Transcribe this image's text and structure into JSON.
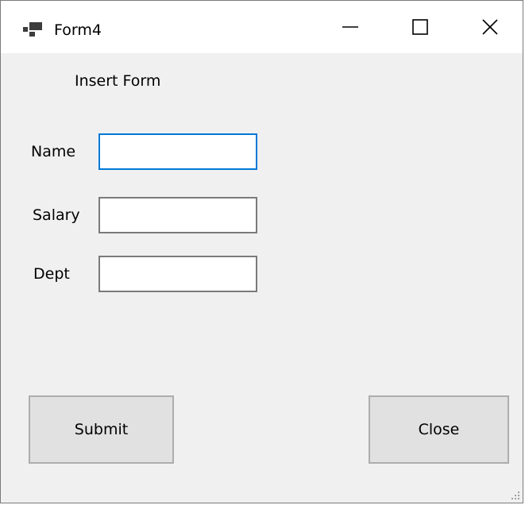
{
  "window": {
    "title": "Form4",
    "icon": "winforms-app-icon",
    "controls": [
      "minimize-icon",
      "maximize-icon",
      "close-icon"
    ]
  },
  "form": {
    "heading": "Insert Form",
    "fields": {
      "name": {
        "label": "Name",
        "value": ""
      },
      "salary": {
        "label": "Salary",
        "value": ""
      },
      "dept": {
        "label": "Dept",
        "value": ""
      }
    },
    "buttons": {
      "submit": "Submit",
      "close": "Close"
    }
  },
  "colors": {
    "focus_border": "#0078d7",
    "form_background": "#f0f0f0",
    "button_face": "#e1e1e1"
  }
}
